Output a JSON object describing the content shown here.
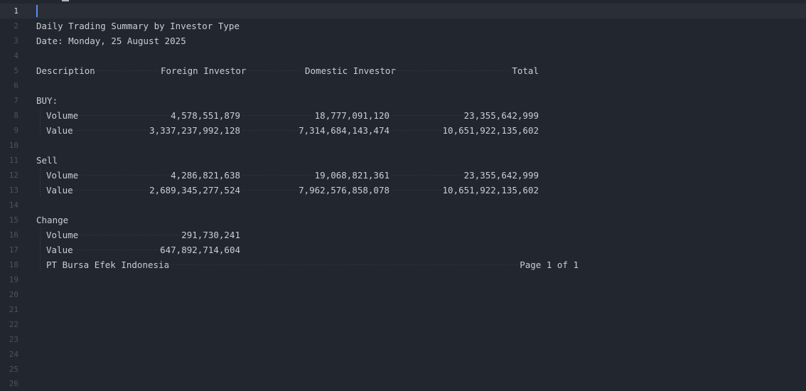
{
  "report": {
    "title": "Daily Trading Summary by Investor Type",
    "date": "Date: Monday, 25 August 2025",
    "headers": {
      "description": "Description",
      "foreign": "Foreign Investor",
      "domestic": "Domestic Investor",
      "total": "Total"
    },
    "buy": {
      "label": "BUY:",
      "volume": {
        "label": "Volume",
        "foreign": "4,578,551,879",
        "domestic": "18,777,091,120",
        "total": "23,355,642,999"
      },
      "value": {
        "label": "Value",
        "foreign": "3,337,237,992,128",
        "domestic": "7,314,684,143,474",
        "total": "10,651,922,135,602"
      }
    },
    "sell": {
      "label": "Sell",
      "volume": {
        "label": "Volume",
        "foreign": "4,286,821,638",
        "domestic": "19,068,821,361",
        "total": "23,355,642,999"
      },
      "value": {
        "label": "Value",
        "foreign": "2,689,345,277,524",
        "domestic": "7,962,576,858,078",
        "total": "10,651,922,135,602"
      }
    },
    "change": {
      "label": "Change",
      "volume": {
        "label": "Volume",
        "foreign": "291,730,241"
      },
      "value": {
        "label": "Value",
        "foreign": "647,892,714,604"
      }
    },
    "footer": {
      "company": "PT Bursa Efek Indonesia",
      "page": "Page 1 of 1"
    }
  },
  "line_numbers": [
    "1",
    "2",
    "3",
    "4",
    "5",
    "6",
    "7",
    "8",
    "9",
    "10",
    "11",
    "12",
    "13",
    "14",
    "15",
    "16",
    "17",
    "18",
    "19",
    "20",
    "21",
    "22",
    "23",
    "24",
    "25",
    "26"
  ]
}
